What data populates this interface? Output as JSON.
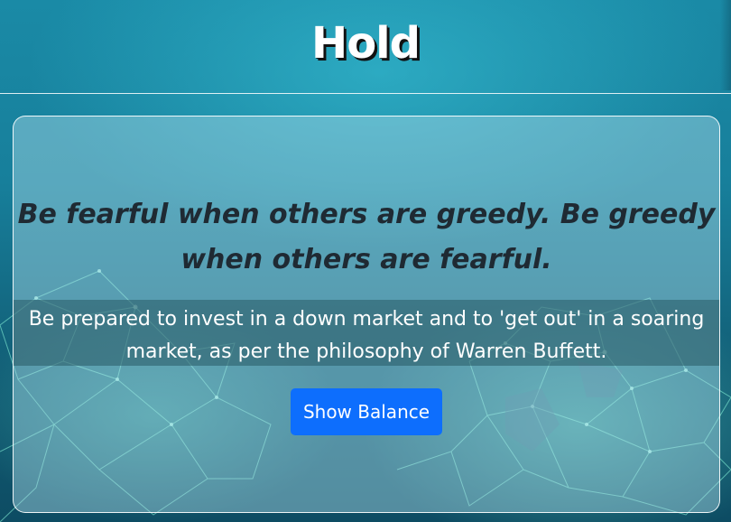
{
  "header": {
    "title": "Hold"
  },
  "card": {
    "quote": "Be fearful when others are greedy. Be greedy when others are fearful.",
    "description": "Be prepared to invest in a down market and to 'get out' in a soaring market, as per the philosophy of Warren Buffett.",
    "button_label": "Show Balance"
  },
  "colors": {
    "button": "#0d6efd",
    "background_teal": "#177f9b",
    "network_glow": "#7affdc",
    "title_text": "#ffffff"
  },
  "background": {
    "image": "network-polygon-background"
  }
}
